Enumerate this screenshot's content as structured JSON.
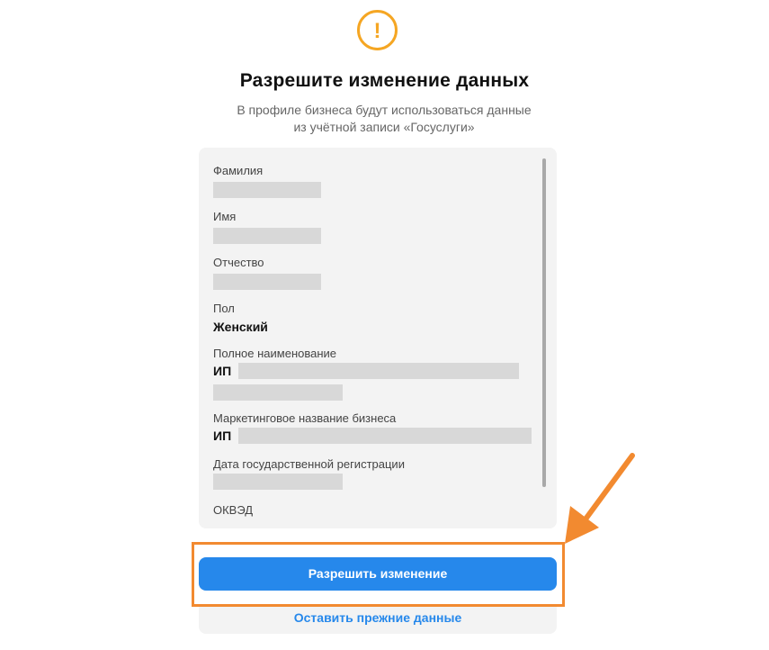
{
  "header": {
    "icon": "exclamation-circle-icon",
    "icon_glyph": "!",
    "title": "Разрешите изменение данных",
    "subtitle_line1": "В профиле бизнеса будут использоваться данные",
    "subtitle_line2": "из учётной записи «Госуслуги»"
  },
  "fields": {
    "surname_label": "Фамилия",
    "name_label": "Имя",
    "patronymic_label": "Отчество",
    "gender_label": "Пол",
    "gender_value": "Женский",
    "full_name_label": "Полное наименование",
    "full_name_prefix": "ИП",
    "marketing_name_label": "Маркетинговое название бизнеса",
    "marketing_name_prefix": "ИП",
    "reg_date_label": "Дата государственной регистрации",
    "okved_label": "ОКВЭД"
  },
  "actions": {
    "allow_label": "Разрешить изменение",
    "keep_label": "Оставить прежние данные"
  },
  "colors": {
    "accent": "#2688eb",
    "warning": "#f5a623",
    "annotation": "#f28a30"
  }
}
